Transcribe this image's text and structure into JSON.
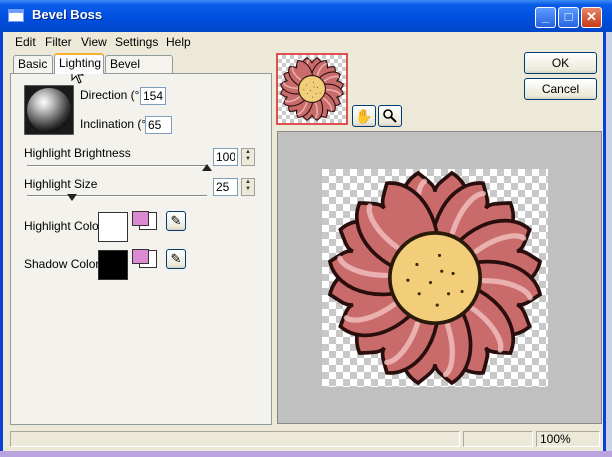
{
  "window": {
    "title": "Bevel Boss"
  },
  "titlebar_buttons": {
    "minimize": "_",
    "maximize": "□",
    "close": "✕"
  },
  "menu": [
    "Edit",
    "Filter",
    "View",
    "Settings",
    "Help"
  ],
  "tabs": [
    {
      "label": "Basic"
    },
    {
      "label": "Lighting",
      "selected": true
    },
    {
      "label": "Bevel Profile"
    }
  ],
  "lighting": {
    "direction_label": "Direction (°)",
    "direction_value": "154",
    "inclination_label": "Inclination (°)",
    "inclination_value": "65",
    "highlight_brightness_label": "Highlight Brightness",
    "highlight_brightness_value": "100",
    "highlight_brightness_level": 1.0,
    "highlight_size_label": "Highlight Size",
    "highlight_size_value": "25",
    "highlight_size_level": 0.25,
    "highlight_color_label": "Highlight Color",
    "highlight_color": "#ffffff",
    "shadow_color_label": "Shadow Color",
    "shadow_color": "#000000",
    "swatch_accent": "#d98ad0"
  },
  "buttons": {
    "ok": "OK",
    "cancel": "Cancel"
  },
  "tools": {
    "pan": "hand-icon",
    "zoom": "magnifier-icon"
  },
  "status": {
    "zoom": "100%"
  },
  "colors": {
    "accent": "#0054e3",
    "tab_highlight": "#f8b133",
    "flower_petal": "#c96b6b",
    "flower_center": "#f2cd7a"
  }
}
